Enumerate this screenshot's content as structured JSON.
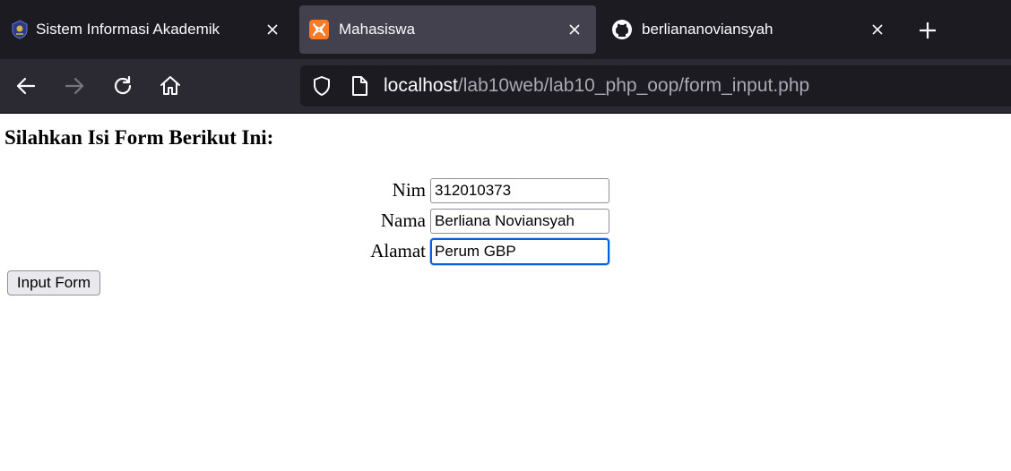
{
  "browser": {
    "tabs": [
      {
        "title": "Sistem Informasi Akademik",
        "favicon": "university-logo-icon",
        "active": false
      },
      {
        "title": "Mahasiswa",
        "favicon": "xampp-icon",
        "active": true
      },
      {
        "title": "berliananoviansyah",
        "favicon": "github-icon",
        "active": false
      }
    ],
    "url": {
      "host": "localhost",
      "path": "/lab10web/lab10_php_oop/form_input.php"
    },
    "colors": {
      "tabbar": "#1c1b22",
      "active_tab": "#42414d",
      "navbar": "#2b2a33",
      "xampp_orange": "#fb7a24"
    }
  },
  "page": {
    "title": "Silahkan Isi Form Berikut Ini:",
    "fields": [
      {
        "label": "Nim",
        "value": "312010373"
      },
      {
        "label": "Nama",
        "value": "Berliana Noviansyah"
      },
      {
        "label": "Alamat",
        "value": "Perum GBP"
      }
    ],
    "submit_label": "Input Form"
  }
}
